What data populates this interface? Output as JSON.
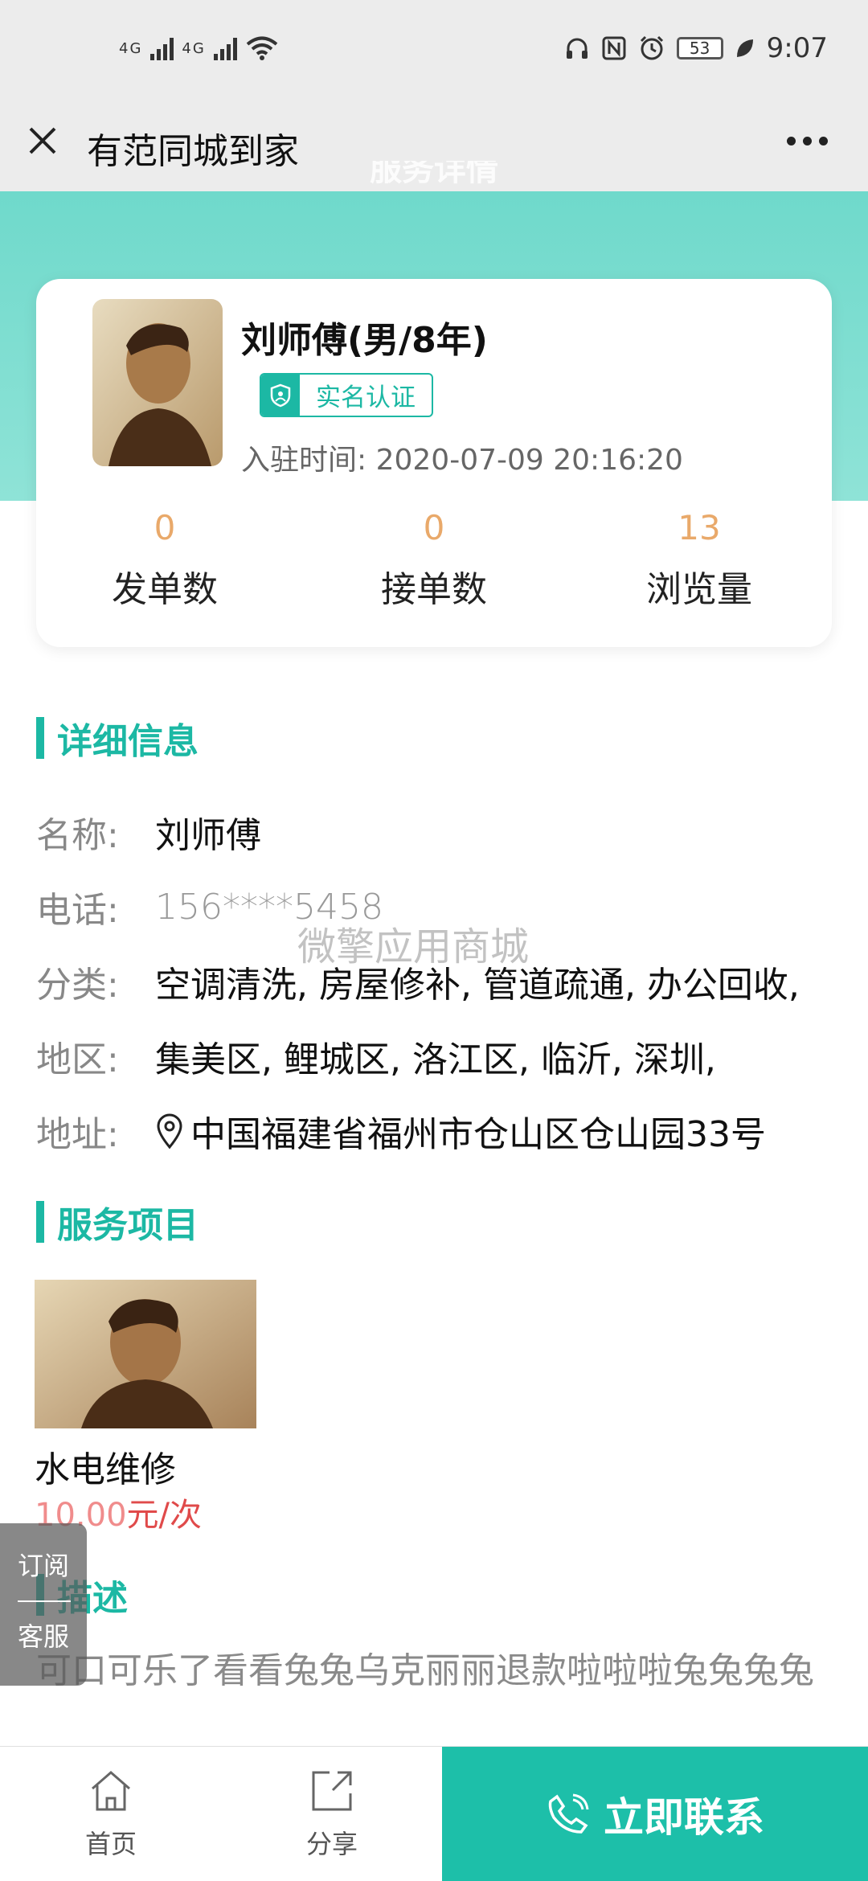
{
  "status": {
    "network_left": "4G",
    "network_right": "4G",
    "battery": "53",
    "time": "9:07"
  },
  "nav": {
    "title": "有范同城到家"
  },
  "hero": {
    "partial_title": "服务详情"
  },
  "profile": {
    "name": "刘师傅(男/8年)",
    "verify_label": "实名认证",
    "join_label": "入驻时间:",
    "join_time": "2020-07-09 20:16:20",
    "stats": [
      {
        "value": "0",
        "label": "发单数"
      },
      {
        "value": "0",
        "label": "接单数"
      },
      {
        "value": "13",
        "label": "浏览量"
      }
    ]
  },
  "detail": {
    "heading": "详细信息",
    "rows": [
      {
        "key": "名称:",
        "value": "刘师傅"
      },
      {
        "key": "电话:",
        "value": "156****5458"
      },
      {
        "key": "分类:",
        "value": "空调清洗, 房屋修补, 管道疏通, 办公回收,"
      },
      {
        "key": "地区:",
        "value": "集美区, 鲤城区, 洛江区, 临沂, 深圳,"
      },
      {
        "key": "地址:",
        "value": "中国福建省福州市仓山区仓山园33号"
      }
    ]
  },
  "watermark": "微擎应用商城",
  "services": {
    "heading": "服务项目",
    "item": {
      "name": "水电维修",
      "price": "10.00",
      "unit": "元/次"
    }
  },
  "description": {
    "heading": "描述",
    "text": "可口可乐了看看兔兔乌克丽丽退款啦啦啦兔兔兔兔"
  },
  "float": {
    "subscribe": "订阅",
    "service": "客服"
  },
  "bottom": {
    "home": "首页",
    "share": "分享",
    "contact": "立即联系"
  },
  "colors": {
    "accent": "#1cb8a4",
    "stat_number": "#e9a96a",
    "price": "#e04a4a"
  }
}
